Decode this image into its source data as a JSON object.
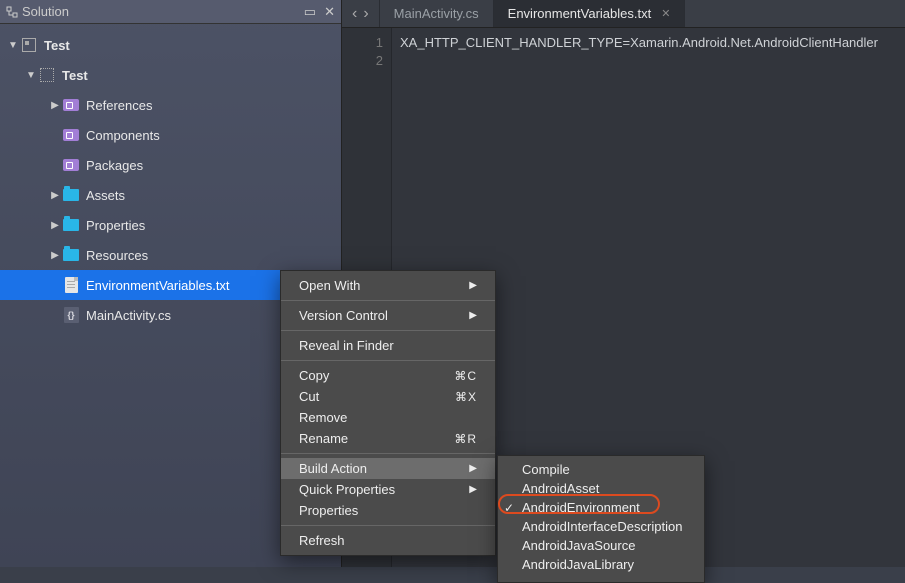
{
  "panel": {
    "title": "Solution"
  },
  "tree": {
    "solution": "Test",
    "project": "Test",
    "items": [
      {
        "label": "References",
        "icon": "lib",
        "arrow": "right"
      },
      {
        "label": "Components",
        "icon": "lib",
        "arrow": "none"
      },
      {
        "label": "Packages",
        "icon": "lib",
        "arrow": "none"
      },
      {
        "label": "Assets",
        "icon": "folder",
        "arrow": "right"
      },
      {
        "label": "Properties",
        "icon": "folder",
        "arrow": "right"
      },
      {
        "label": "Resources",
        "icon": "folder",
        "arrow": "right"
      },
      {
        "label": "EnvironmentVariables.txt",
        "icon": "file",
        "arrow": "none",
        "selected": true
      },
      {
        "label": "MainActivity.cs",
        "icon": "cs",
        "arrow": "none"
      }
    ]
  },
  "tabs": {
    "inactive": "MainActivity.cs",
    "active": "EnvironmentVariables.txt"
  },
  "code": {
    "lines": [
      "1",
      "2"
    ],
    "text": "XA_HTTP_CLIENT_HANDLER_TYPE=Xamarin.Android.Net.AndroidClientHandler"
  },
  "context_menu": {
    "items": [
      {
        "label": "Open With",
        "sub": true
      },
      "sep",
      {
        "label": "Version Control",
        "sub": true
      },
      "sep",
      {
        "label": "Reveal in Finder"
      },
      "sep",
      {
        "label": "Copy",
        "shortcut": "⌘C"
      },
      {
        "label": "Cut",
        "shortcut": "⌘X"
      },
      {
        "label": "Remove"
      },
      {
        "label": "Rename",
        "shortcut": "⌘R"
      },
      "sep",
      {
        "label": "Build Action",
        "sub": true,
        "hover": true
      },
      {
        "label": "Quick Properties",
        "sub": true
      },
      {
        "label": "Properties"
      },
      "sep",
      {
        "label": "Refresh"
      }
    ]
  },
  "submenu": {
    "items": [
      {
        "label": "Compile"
      },
      {
        "label": "AndroidAsset"
      },
      {
        "label": "AndroidEnvironment",
        "checked": true,
        "highlighted": true
      },
      {
        "label": "AndroidInterfaceDescription"
      },
      {
        "label": "AndroidJavaSource"
      },
      {
        "label": "AndroidJavaLibrary"
      }
    ]
  }
}
